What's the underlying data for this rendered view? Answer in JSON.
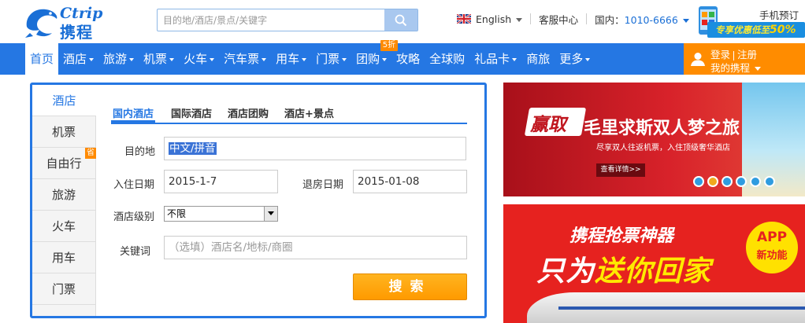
{
  "brand": {
    "logo_top": "Ctrip",
    "logo_bottom": "携程",
    "colors": {
      "primary": "#2577e3",
      "accent": "#ff8c00",
      "logo": "#1a6fd6"
    }
  },
  "search": {
    "placeholder": "目的地/酒店/景点/关键字"
  },
  "top_links": {
    "language": "English",
    "service": "客服中心",
    "hotline_label": "国内：",
    "hotline_number": "1010-6666"
  },
  "mobile_promo": {
    "title": "手机预订",
    "text": "专享优惠低至",
    "percent": "50%"
  },
  "nav": {
    "items": [
      {
        "label": "首页",
        "active": true
      },
      {
        "label": "酒店",
        "caret": true
      },
      {
        "label": "旅游",
        "caret": true
      },
      {
        "label": "机票",
        "caret": true
      },
      {
        "label": "火车",
        "caret": true
      },
      {
        "label": "汽车票",
        "caret": true
      },
      {
        "label": "用车",
        "caret": true
      },
      {
        "label": "门票",
        "caret": true
      },
      {
        "label": "团购",
        "caret": true,
        "badge": "5折"
      },
      {
        "label": "攻略"
      },
      {
        "label": "全球购"
      },
      {
        "label": "礼品卡",
        "caret": true
      },
      {
        "label": "商旅"
      },
      {
        "label": "更多",
        "caret": true
      }
    ]
  },
  "account": {
    "login": "登录",
    "register": "注册",
    "my_ctrip": "我的携程"
  },
  "side_tabs": [
    {
      "label": "酒店",
      "active": true
    },
    {
      "label": "机票"
    },
    {
      "label": "自由行",
      "badge": "省"
    },
    {
      "label": "旅游"
    },
    {
      "label": "火车"
    },
    {
      "label": "用车"
    },
    {
      "label": "门票"
    }
  ],
  "sub_tabs": [
    {
      "label": "国内酒店",
      "active": true
    },
    {
      "label": "国际酒店"
    },
    {
      "label": "酒店团购"
    },
    {
      "label": "酒店+景点"
    }
  ],
  "form": {
    "destination_label": "目的地",
    "destination_value": "中文/拼音",
    "checkin_label": "入住日期",
    "checkin_value": "2015-1-7",
    "checkout_label": "退房日期",
    "checkout_value": "2015-01-08",
    "level_label": "酒店级别",
    "level_value": "不限",
    "keyword_label": "关键词",
    "keyword_placeholder": "（选填）酒店名/地标/商圈",
    "submit": "搜索"
  },
  "banner1": {
    "tag": "赢取",
    "title": "毛里求斯双人梦之旅",
    "subtitle": "尽享双人往返机票，入住顶级奢华酒店",
    "button": "查看详情>>",
    "dots": 6,
    "active_dot": 2
  },
  "banner2": {
    "title": "携程抢票神器",
    "main_prefix": "只为",
    "main_highlight": "送你回家",
    "app_line1": "APP",
    "app_line2": "新功能"
  }
}
